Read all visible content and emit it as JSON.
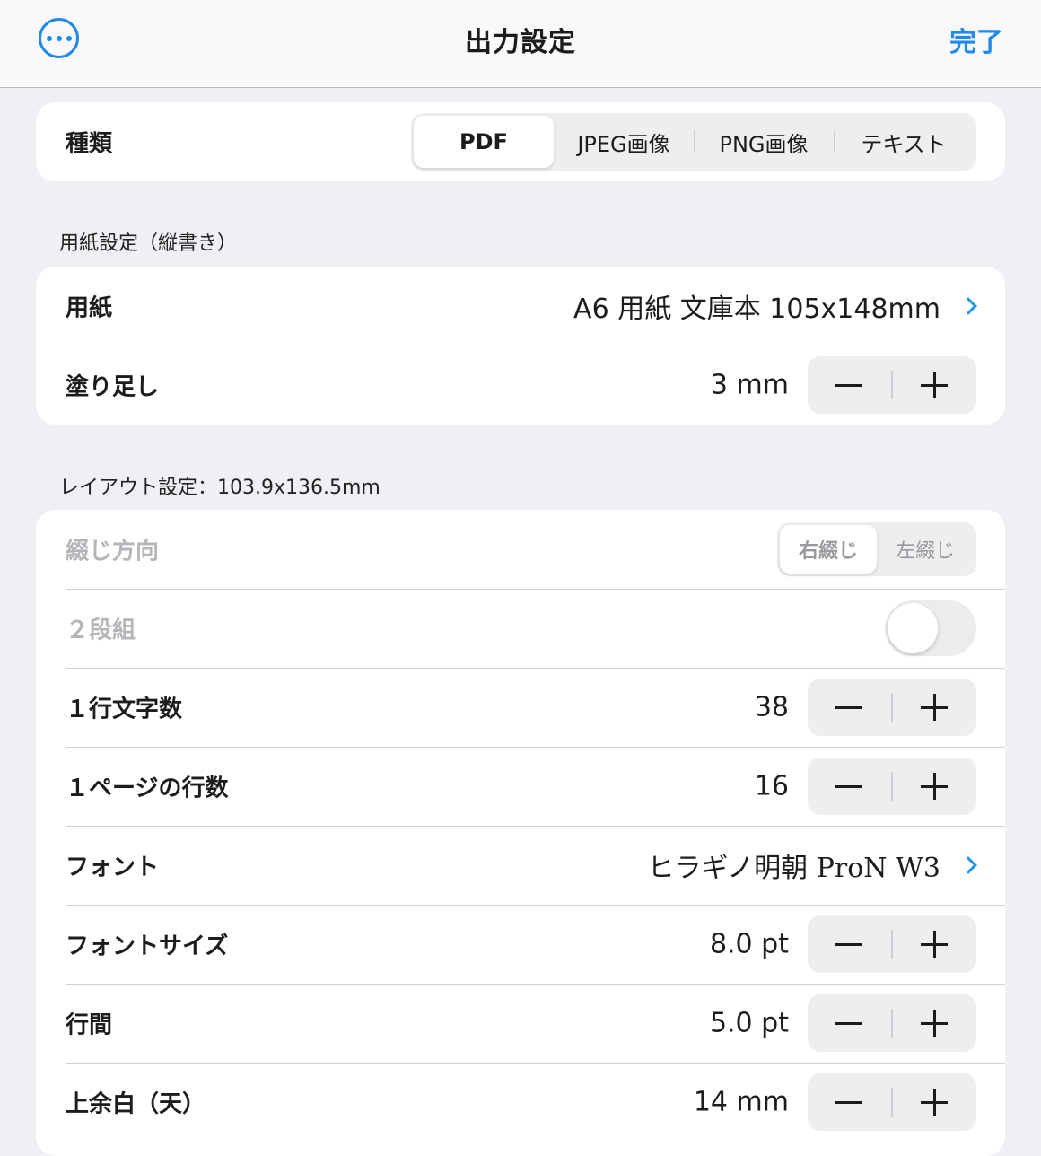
{
  "navbar": {
    "title": "出力設定",
    "done_label": "完了",
    "more_icon": "ellipsis-circle-icon"
  },
  "type_card": {
    "label": "種類",
    "options": [
      "PDF",
      "JPEG画像",
      "PNG画像",
      "テキスト"
    ],
    "selected": "PDF"
  },
  "paper_section": {
    "header": "用紙設定（縦書き）",
    "rows": [
      {
        "label": "用紙",
        "value": "A6 用紙 文庫本 105x148mm"
      },
      {
        "label": "塗り足し",
        "value": "3 mm"
      }
    ]
  },
  "layout_section": {
    "header": "レイアウト設定：103.9x136.5mm",
    "binding": {
      "label": "綴じ方向",
      "options": [
        "右綴じ",
        "左綴じ"
      ],
      "selected": "右綴じ",
      "enabled": false
    },
    "two_column": {
      "label": "２段組",
      "on": false,
      "enabled": false
    },
    "rows": [
      {
        "label": "１行文字数",
        "value": "38"
      },
      {
        "label": "１ページの行数",
        "value": "16"
      },
      {
        "label": "フォント",
        "value": "ヒラギノ明朝 ProN W3"
      },
      {
        "label": "フォントサイズ",
        "value": "8.0 pt"
      },
      {
        "label": "行間",
        "value": "5.0 pt"
      },
      {
        "label": "上余白（天）",
        "value": "14 mm"
      }
    ]
  },
  "colors": {
    "accent": "#1f8ae8",
    "background": "#f0eff4",
    "card": "#ffffff"
  }
}
